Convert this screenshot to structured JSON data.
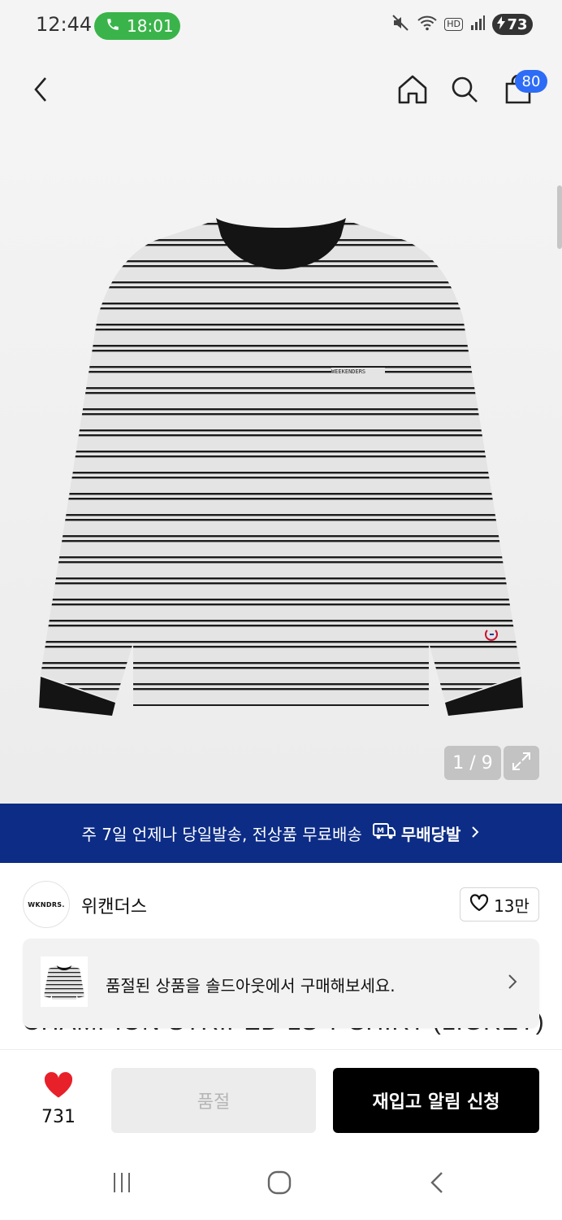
{
  "status_bar": {
    "time": "12:44",
    "call_timer": "18:01",
    "hd_label": "HD",
    "battery": "73"
  },
  "header": {
    "cart_count": "80"
  },
  "gallery": {
    "counter": "1 / 9",
    "shirt_print": "WEEKENDERS"
  },
  "banner": {
    "text": "주 7일 언제나 당일발송, 전상품 무료배송",
    "brand": "무배당발"
  },
  "brand": {
    "logo_text": "WKNDRS.",
    "name": "위캔더스",
    "like_count": "13만"
  },
  "product": {
    "title": "CHAMPION STRIPED LS T-SHIRT (L.GREY)"
  },
  "soldout_toast": {
    "message": "품절된 상품을 솔드아웃에서 구매해보세요."
  },
  "action_bar": {
    "wish_count": "731",
    "soldout_label": "품절",
    "restock_label": "재입고 알림 신청"
  },
  "colors": {
    "banner_bg": "#0c2c86",
    "badge": "#2d6cf6",
    "heart": "#e8202a",
    "call_pill": "#3ab44a"
  }
}
